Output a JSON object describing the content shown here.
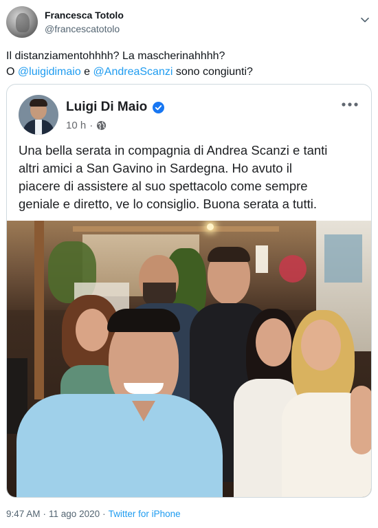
{
  "author": {
    "name": "Francesca Totolo",
    "handle": "@francescatotolo"
  },
  "tweet": {
    "line1": "Il distanziamentohhhh? La mascherinahhhh?",
    "line2_prefix": "O ",
    "mention1": "@luigidimaio",
    "line2_mid": " e ",
    "mention2": "@AndreaScanzi",
    "line2_suffix": " sono congiunti?"
  },
  "embed": {
    "page_name": "Luigi Di Maio",
    "time": "10 h",
    "dot": "·",
    "text_lines": [
      "Una bella serata in compagnia di Andrea Scanzi e tanti",
      "altri amici a San Gavino in Sardegna. Ho avuto il",
      "piacere di assistere al suo spettacolo come sempre",
      "geniale e diretto, ve lo consiglio. Buona serata a tutti."
    ]
  },
  "footer": {
    "time": "9:47 AM",
    "dot": "·",
    "date": "11 ago 2020",
    "dot2": "·",
    "source": "Twitter for iPhone"
  },
  "colors": {
    "link": "#1d9bf0",
    "verified": "#1877f2",
    "muted": "#536471"
  }
}
